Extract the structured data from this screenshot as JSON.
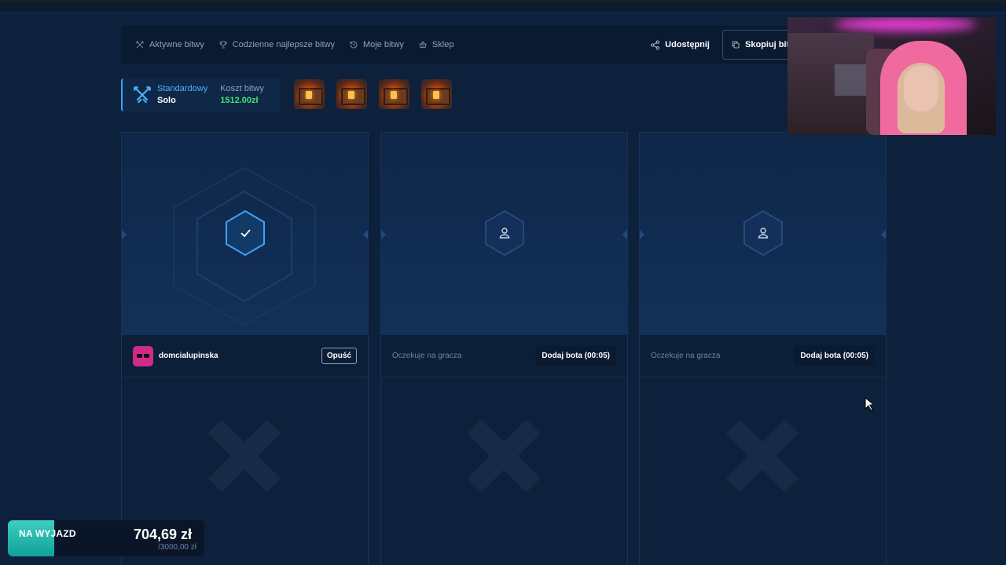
{
  "nav": {
    "items": [
      {
        "label": "Aktywne bitwy",
        "icon": "swords-icon"
      },
      {
        "label": "Codzienne najlepsze bitwy",
        "icon": "trophy-icon"
      },
      {
        "label": "Moje bitwy",
        "icon": "history-icon"
      },
      {
        "label": "Sklep",
        "icon": "basket-icon"
      }
    ],
    "share_label": "Udostępnij",
    "copy_label": "Skopiuj bitwę"
  },
  "battle": {
    "mode_label": "Standardowy",
    "mode_sub": "Solo",
    "cost_label": "Koszt bitwy",
    "cost_value": "1512.00zł",
    "case_count": 4
  },
  "players": [
    {
      "state": "ready",
      "name": "domcialupinska",
      "action": "Opuść"
    },
    {
      "state": "waiting",
      "name": "Oczekuje na gracza",
      "action": "Dodaj bota (00:05)"
    },
    {
      "state": "waiting",
      "name": "Oczekuje na gracza",
      "action": "Dodaj bota (00:05)"
    }
  ],
  "goal": {
    "label": "NA WYJAZD",
    "amount": "704,69 zł",
    "target": "/3000,00 zł",
    "progress": 0.2349
  },
  "colors": {
    "accent": "#4ab1ff",
    "cost_green": "#3ee07a",
    "background": "#0d213c",
    "avatar": "#d02a8a",
    "goal_fill": "#3ecfc0"
  }
}
